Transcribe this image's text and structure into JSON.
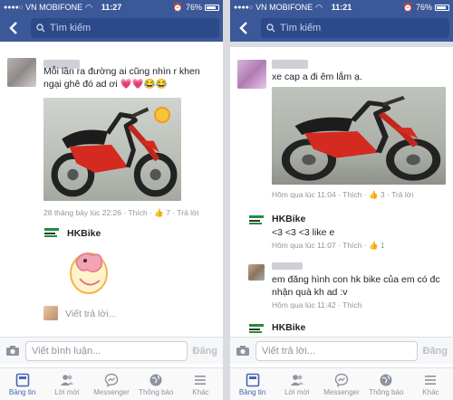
{
  "colors": {
    "fb_blue": "#3b5998",
    "link_blue": "#4267b2",
    "meta_grey": "#90949c"
  },
  "left": {
    "status": {
      "carrier": "VN MOBIFONE",
      "time": "11:27",
      "battery": "76%"
    },
    "search_placeholder": "Tìm kiếm",
    "comment1": {
      "text": "Mỗi lần ra đường ai cũng nhìn r khen ngại ghê đó ad ơi 💗💗😂😂",
      "time": "28 tháng bảy lúc 22:26",
      "like_label": "Thích",
      "like_count": "7",
      "reply_label": "Trả lời"
    },
    "reply1": {
      "name": "HKBike"
    },
    "reply_prompt": "Viết trả lời...",
    "comment_placeholder": "Viết bình luận...",
    "post_label": "Đăng",
    "tabs": [
      {
        "label": "Bảng tin",
        "icon": "news-feed-icon"
      },
      {
        "label": "Lời mời",
        "icon": "friend-requests-icon"
      },
      {
        "label": "Messenger",
        "icon": "messenger-icon"
      },
      {
        "label": "Thông báo",
        "icon": "globe-icon"
      },
      {
        "label": "Khác",
        "icon": "menu-icon"
      }
    ]
  },
  "right": {
    "status": {
      "carrier": "VN MOBIFONE",
      "time": "11:21",
      "battery": "76%"
    },
    "search_placeholder": "Tìm kiếm",
    "comment1": {
      "text": "xe cap a đi êm lắm ạ.",
      "time": "Hôm qua lúc 11:04",
      "like_label": "Thích",
      "like_count": "3",
      "reply_label": "Trả lời"
    },
    "reply1": {
      "name": "HKBike",
      "text": "<3 <3 <3 like e",
      "time": "Hôm qua lúc 11:07",
      "like_label": "Thích",
      "like_count": "1"
    },
    "comment2": {
      "text": "em đăng hình con hk bike của em có đc nhận quà kh ad :v",
      "time": "Hôm qua lúc 11:42",
      "like_label": "Thích"
    },
    "reply2": {
      "name": "HKBike"
    },
    "comment_placeholder": "Viết trả lời...",
    "post_label": "Đăng",
    "tabs": [
      {
        "label": "Bảng tin",
        "icon": "news-feed-icon"
      },
      {
        "label": "Lời mời",
        "icon": "friend-requests-icon"
      },
      {
        "label": "Messenger",
        "icon": "messenger-icon"
      },
      {
        "label": "Thông báo",
        "icon": "globe-icon"
      },
      {
        "label": "Khác",
        "icon": "menu-icon"
      }
    ]
  }
}
